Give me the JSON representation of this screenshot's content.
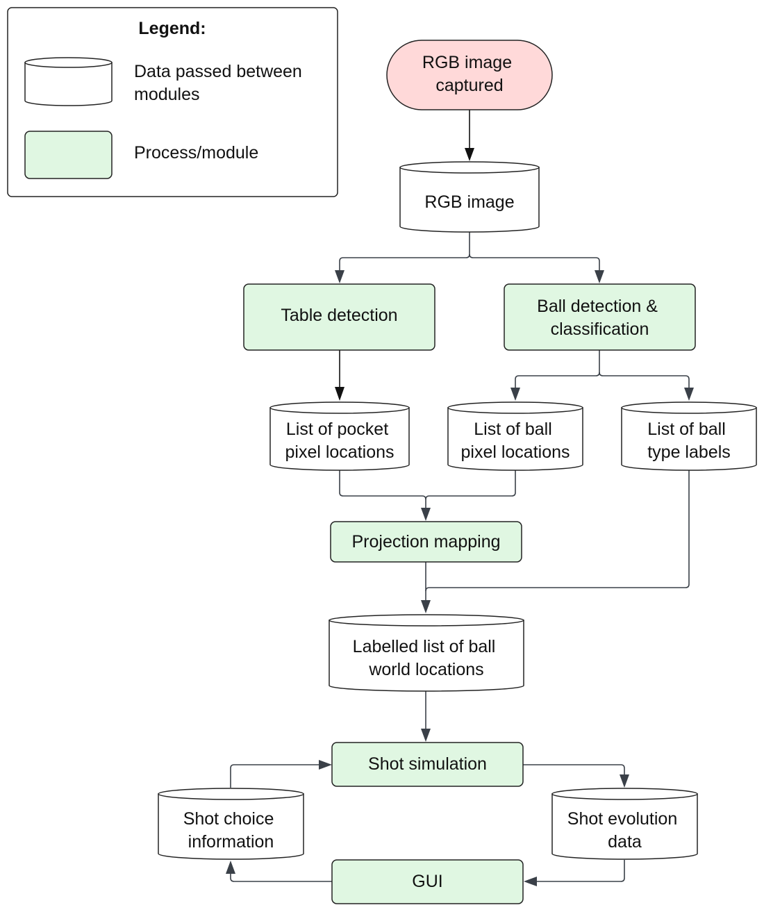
{
  "legend": {
    "title": "Legend:",
    "items": [
      {
        "shape": "cylinder",
        "lines": [
          "Data passed between",
          "modules"
        ]
      },
      {
        "shape": "process",
        "lines": [
          "Process/module"
        ]
      }
    ]
  },
  "colors": {
    "process_fill": "#e0f7e2",
    "terminal_fill": "#ffd9d9",
    "data_fill": "#ffffff",
    "edge": "#3a4048"
  },
  "nodes": {
    "rgb_captured": {
      "type": "terminal",
      "lines": [
        "RGB image",
        "captured"
      ]
    },
    "rgb_image": {
      "type": "data",
      "lines": [
        "RGB image"
      ]
    },
    "table_detection": {
      "type": "process",
      "lines": [
        "Table detection"
      ]
    },
    "ball_detection": {
      "type": "process",
      "lines": [
        "Ball detection &",
        "classification"
      ]
    },
    "pocket_pixels": {
      "type": "data",
      "lines": [
        "List of pocket",
        "pixel locations"
      ]
    },
    "ball_pixels": {
      "type": "data",
      "lines": [
        "List of ball",
        "pixel locations"
      ]
    },
    "ball_labels": {
      "type": "data",
      "lines": [
        "List of ball",
        "type labels"
      ]
    },
    "projection": {
      "type": "process",
      "lines": [
        "Projection mapping"
      ]
    },
    "world_locations": {
      "type": "data",
      "lines": [
        "Labelled list of ball",
        "world locations"
      ]
    },
    "shot_simulation": {
      "type": "process",
      "lines": [
        "Shot simulation"
      ]
    },
    "shot_choice": {
      "type": "data",
      "lines": [
        "Shot choice",
        "information"
      ]
    },
    "shot_evolution": {
      "type": "data",
      "lines": [
        "Shot evolution",
        "data"
      ]
    },
    "gui": {
      "type": "process",
      "lines": [
        "GUI"
      ]
    }
  },
  "edges": [
    {
      "from": "rgb_captured",
      "to": "rgb_image"
    },
    {
      "from": "rgb_image",
      "to": "table_detection"
    },
    {
      "from": "rgb_image",
      "to": "ball_detection"
    },
    {
      "from": "table_detection",
      "to": "pocket_pixels"
    },
    {
      "from": "ball_detection",
      "to": "ball_pixels"
    },
    {
      "from": "ball_detection",
      "to": "ball_labels"
    },
    {
      "from": "pocket_pixels",
      "to": "projection"
    },
    {
      "from": "ball_pixels",
      "to": "projection"
    },
    {
      "from": "projection",
      "to": "world_locations"
    },
    {
      "from": "ball_labels",
      "to": "world_locations"
    },
    {
      "from": "world_locations",
      "to": "shot_simulation"
    },
    {
      "from": "shot_simulation",
      "to": "shot_evolution"
    },
    {
      "from": "shot_evolution",
      "to": "gui"
    },
    {
      "from": "gui",
      "to": "shot_choice"
    },
    {
      "from": "shot_choice",
      "to": "shot_simulation"
    }
  ]
}
